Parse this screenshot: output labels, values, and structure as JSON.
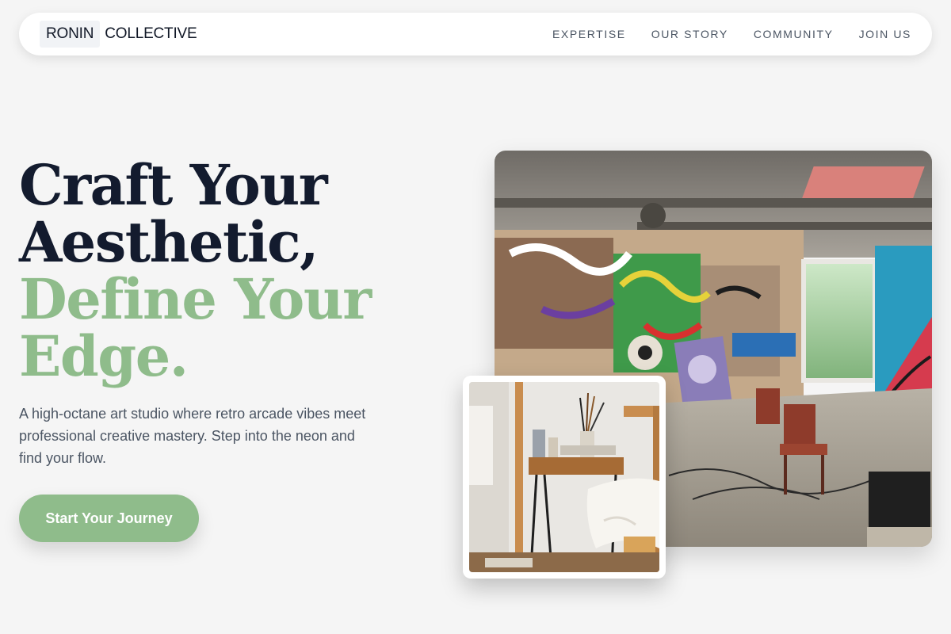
{
  "nav": {
    "logo_boxed": "RONIN",
    "logo_rest": "COLLECTIVE",
    "links": [
      "EXPERTISE",
      "OUR STORY",
      "COMMUNITY",
      "JOIN US"
    ]
  },
  "hero": {
    "headline_line1": "Craft Your",
    "headline_line2": "Aesthetic,",
    "headline_line3": "Define Your",
    "headline_line4": "Edge.",
    "subtitle": "A high-octane art studio where retro arcade vibes meet professional creative mastery. Step into the neon and find your flow.",
    "cta_label": "Start Your Journey"
  },
  "colors": {
    "accent_green": "#8fbc8b",
    "headline_dark": "#131b2e",
    "background": "#f5f5f5",
    "body_text": "#4b5563"
  }
}
